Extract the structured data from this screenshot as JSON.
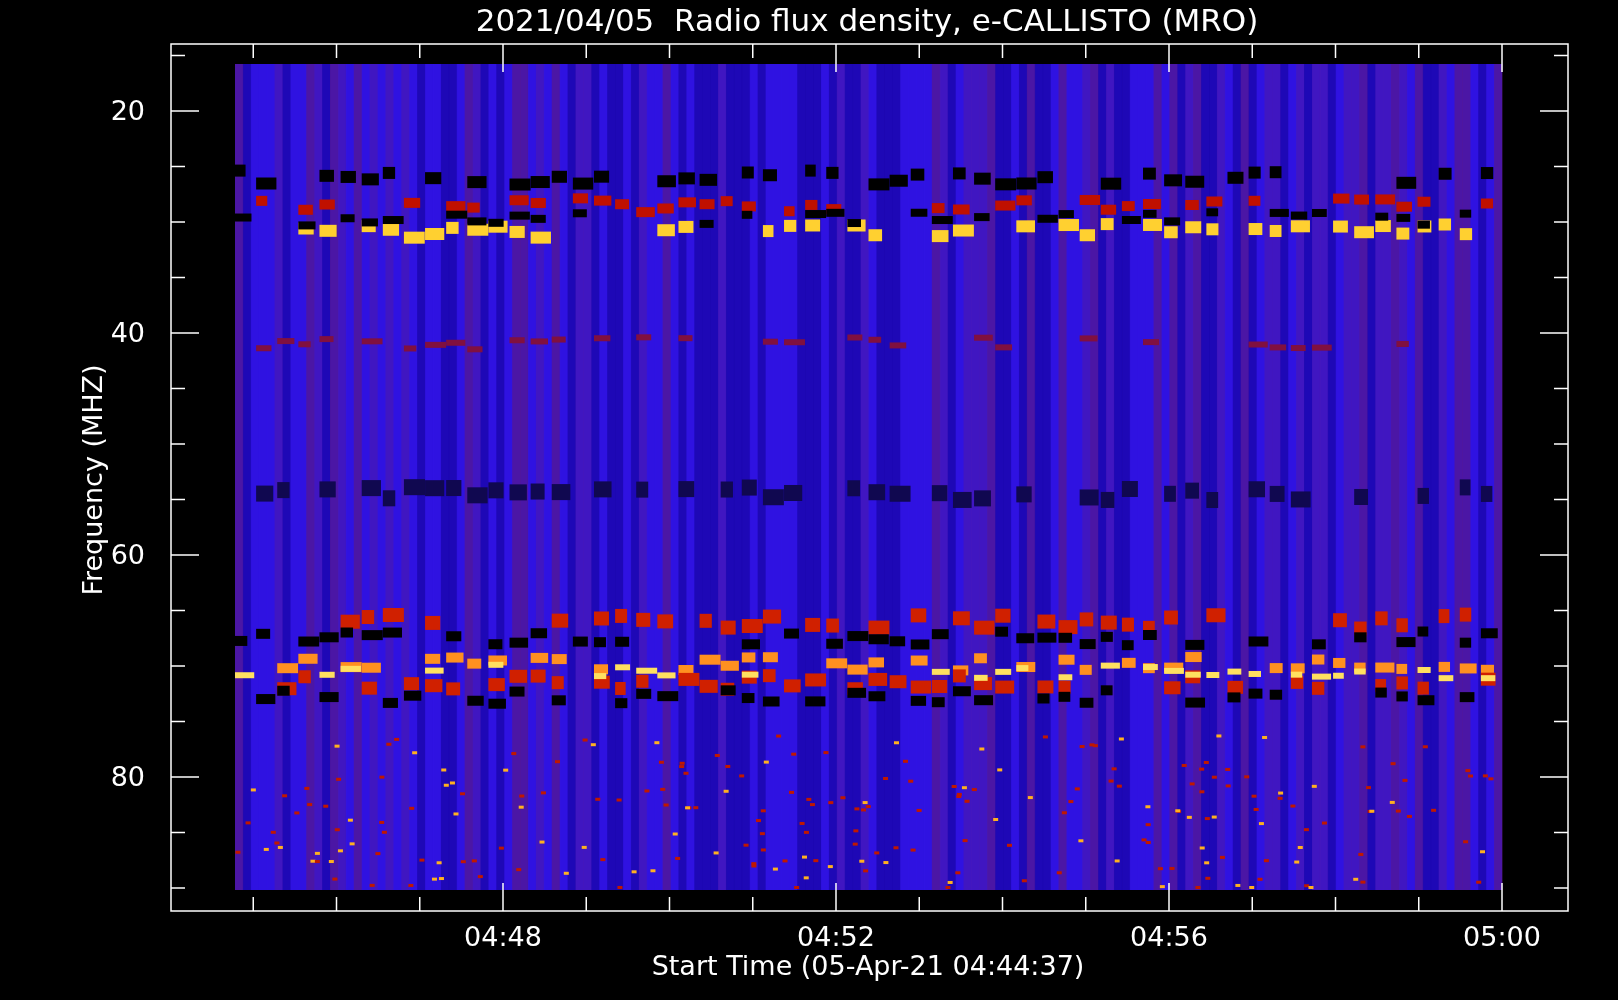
{
  "title": "2021/04/05  Radio flux density, e-CALLISTO (MRO)",
  "y_axis": {
    "label": "Frequency (MHZ)",
    "ticks": [
      "20",
      "40",
      "60",
      "80"
    ]
  },
  "x_axis": {
    "label": "Start Time (05-Apr-21 04:44:37)",
    "ticks": [
      "04:48",
      "04:52",
      "04:56",
      "05:00"
    ]
  }
}
